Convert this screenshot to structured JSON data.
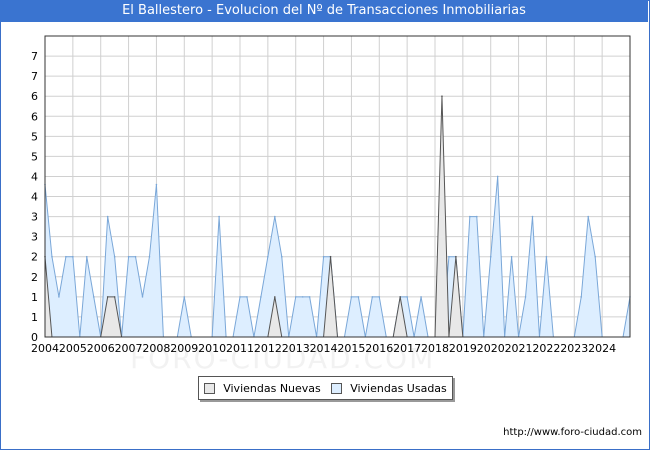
{
  "header": {
    "title": "El Ballestero - Evolucion del Nº de Transacciones Inmobiliarias"
  },
  "footer": {
    "url": "http://www.foro-ciudad.com"
  },
  "watermark": "FORO-CIUDAD.COM",
  "colors": {
    "nuevas_fill": "#e8e8e8",
    "nuevas_stroke": "#555555",
    "usadas_fill": "#ddeeff",
    "usadas_stroke": "#7aa7d8",
    "title_bar": "#3a74d0",
    "grid": "#d0d0d0"
  },
  "chart_data": {
    "type": "area",
    "title": "El Ballestero - Evolucion del Nº de Transacciones Inmobiliarias",
    "xlabel": "",
    "ylabel": "",
    "ylim": [
      0,
      7.5
    ],
    "y_tick_labels": [
      "0",
      "1",
      "1",
      "2",
      "2",
      "3",
      "3",
      "4",
      "4",
      "5",
      "5",
      "6",
      "6",
      "7",
      "7"
    ],
    "x_tick_labels": [
      "2004",
      "2005",
      "2006",
      "2007",
      "2008",
      "2009",
      "2010",
      "2011",
      "2012",
      "2013",
      "2014",
      "2015",
      "2016",
      "2017",
      "2018",
      "2019",
      "2020",
      "2021",
      "2022",
      "2023",
      "2024"
    ],
    "x_range": [
      2004,
      2025
    ],
    "grid": true,
    "legend_position": "bottom-center",
    "series": [
      {
        "name": "Viviendas Usadas",
        "x": [
          2004.0,
          2004.25,
          2004.5,
          2004.75,
          2005.0,
          2005.25,
          2005.5,
          2005.75,
          2006.0,
          2006.25,
          2006.5,
          2006.75,
          2007.0,
          2007.25,
          2007.5,
          2007.75,
          2008.0,
          2008.25,
          2008.5,
          2008.75,
          2009.0,
          2009.25,
          2009.5,
          2009.75,
          2010.0,
          2010.25,
          2010.5,
          2010.75,
          2011.0,
          2011.25,
          2011.5,
          2011.75,
          2012.0,
          2012.25,
          2012.5,
          2012.75,
          2013.0,
          2013.25,
          2013.5,
          2013.75,
          2014.0,
          2014.25,
          2014.5,
          2014.75,
          2015.0,
          2015.25,
          2015.5,
          2015.75,
          2016.0,
          2016.25,
          2016.5,
          2016.75,
          2017.0,
          2017.25,
          2017.5,
          2017.75,
          2018.0,
          2018.25,
          2018.5,
          2018.75,
          2019.0,
          2019.25,
          2019.5,
          2019.75,
          2020.0,
          2020.25,
          2020.5,
          2020.75,
          2021.0,
          2021.25,
          2021.5,
          2021.75,
          2022.0,
          2022.25,
          2022.5,
          2022.75,
          2023.0,
          2023.25,
          2023.5,
          2023.75,
          2024.0,
          2024.25,
          2024.5,
          2024.75,
          2025.0
        ],
        "values": [
          3.8,
          2,
          1,
          2,
          2,
          0,
          2,
          1,
          0,
          3,
          2,
          0,
          2,
          2,
          1,
          2,
          3.8,
          0,
          0,
          0,
          1,
          0,
          0,
          0,
          0,
          3,
          0,
          0,
          1,
          1,
          0,
          1,
          2,
          3,
          2,
          0,
          1,
          1,
          1,
          0,
          2,
          2,
          0,
          0,
          1,
          1,
          0,
          1,
          1,
          0,
          0,
          1,
          1,
          0,
          1,
          0,
          0,
          0,
          2,
          2,
          0,
          3,
          3,
          0,
          2,
          4,
          0,
          2,
          0,
          1,
          3,
          0,
          2,
          0,
          0,
          0,
          0,
          1,
          3,
          2,
          0,
          0,
          0,
          0,
          1
        ]
      },
      {
        "name": "Viviendas Nuevas",
        "x": [
          2004.0,
          2004.25,
          2004.5,
          2004.75,
          2005.0,
          2005.25,
          2005.5,
          2005.75,
          2006.0,
          2006.25,
          2006.5,
          2006.75,
          2007.0,
          2007.25,
          2007.5,
          2007.75,
          2008.0,
          2008.25,
          2008.5,
          2008.75,
          2009.0,
          2009.25,
          2009.5,
          2009.75,
          2010.0,
          2010.25,
          2010.5,
          2010.75,
          2011.0,
          2011.25,
          2011.5,
          2011.75,
          2012.0,
          2012.25,
          2012.5,
          2012.75,
          2013.0,
          2013.25,
          2013.5,
          2013.75,
          2014.0,
          2014.25,
          2014.5,
          2014.75,
          2015.0,
          2015.25,
          2015.5,
          2015.75,
          2016.0,
          2016.25,
          2016.5,
          2016.75,
          2017.0,
          2017.25,
          2017.5,
          2017.75,
          2018.0,
          2018.25,
          2018.5,
          2018.75,
          2019.0,
          2019.25,
          2019.5,
          2019.75,
          2020.0,
          2020.25,
          2020.5,
          2020.75,
          2021.0,
          2021.25,
          2021.5,
          2021.75,
          2022.0,
          2022.25,
          2022.5,
          2022.75,
          2023.0,
          2023.25,
          2023.5,
          2023.75,
          2024.0,
          2024.25,
          2024.5,
          2024.75,
          2025.0
        ],
        "values": [
          2,
          0,
          0,
          0,
          0,
          0,
          0,
          0,
          0,
          1,
          1,
          0,
          0,
          0,
          0,
          0,
          0,
          0,
          0,
          0,
          0,
          0,
          0,
          0,
          0,
          0,
          0,
          0,
          0,
          0,
          0,
          0,
          0,
          1,
          0,
          0,
          0,
          0,
          0,
          0,
          0,
          2,
          0,
          0,
          0,
          0,
          0,
          0,
          0,
          0,
          0,
          1,
          0,
          0,
          0,
          0,
          0,
          6,
          0,
          2,
          0,
          0,
          0,
          0,
          0,
          0,
          0,
          0,
          0,
          0,
          0,
          0,
          0,
          0,
          0,
          0,
          0,
          0,
          0,
          0,
          0,
          0,
          0,
          0,
          0
        ]
      }
    ]
  }
}
